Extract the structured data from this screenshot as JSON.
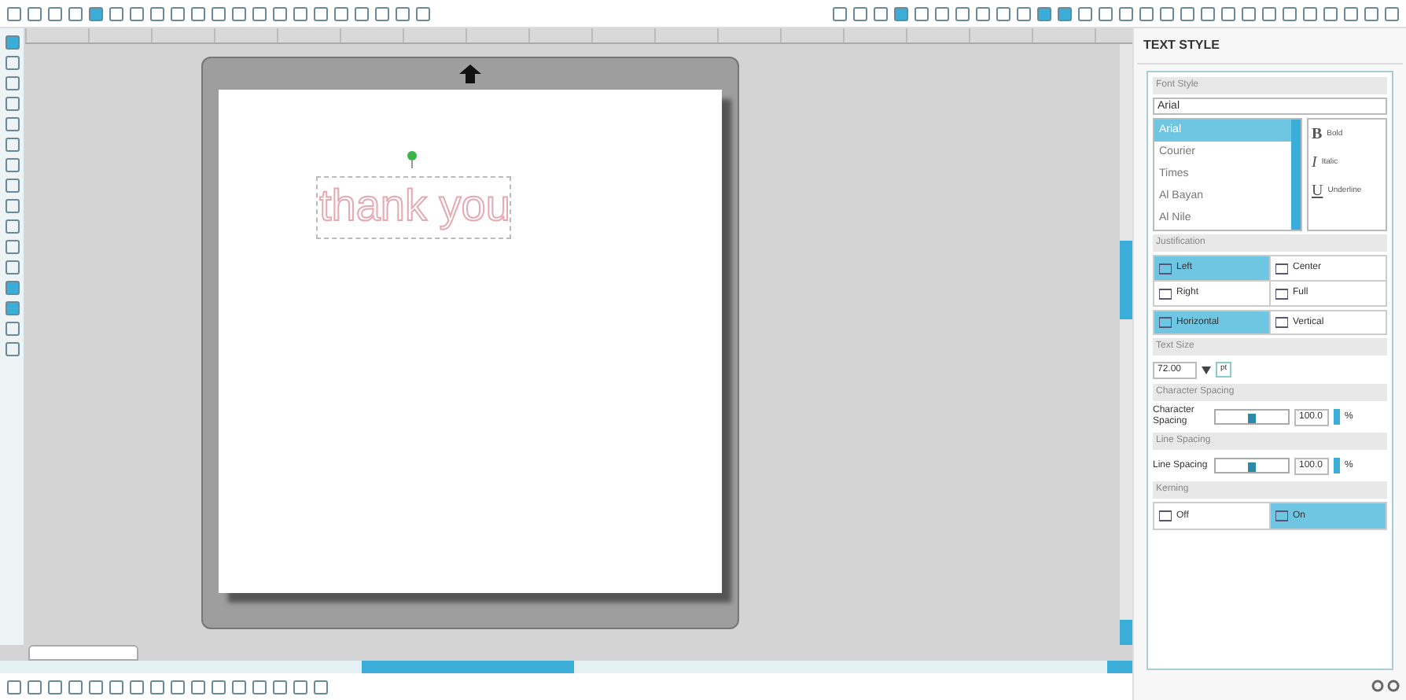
{
  "panel": {
    "title": "TEXT STYLE",
    "font_style": {
      "header": "Font Style",
      "font_field": "Arial",
      "fonts": [
        {
          "label": "Arial",
          "selected": true
        },
        {
          "label": "Courier",
          "selected": false
        },
        {
          "label": "Times",
          "selected": false
        },
        {
          "label": "Al Bayan",
          "selected": false
        },
        {
          "label": "Al Nile",
          "selected": false
        }
      ],
      "styles": [
        {
          "glyph": "B",
          "label": "Bold"
        },
        {
          "glyph": "I",
          "label": "Italic"
        },
        {
          "glyph": "U",
          "label": "Underline"
        }
      ]
    },
    "justification": {
      "header": "Justification",
      "options": [
        {
          "label": "Left",
          "selected": true
        },
        {
          "label": "Center",
          "selected": false
        },
        {
          "label": "Right",
          "selected": false
        },
        {
          "label": "Full",
          "selected": false
        }
      ],
      "orientation": [
        {
          "label": "Horizontal",
          "selected": true
        },
        {
          "label": "Vertical",
          "selected": false
        }
      ]
    },
    "text_size": {
      "header": "Text Size",
      "value": "72.00",
      "unit": "pt"
    },
    "character_spacing": {
      "header": "Character Spacing",
      "label": "Character Spacing",
      "level": 0.5,
      "value": "100.0",
      "unit": "%"
    },
    "line_spacing": {
      "header": "Line Spacing",
      "label": "Line Spacing",
      "level": 0.5,
      "value": "100.0",
      "unit": "%"
    },
    "kerning": {
      "header": "Kerning",
      "options": [
        {
          "label": "Off",
          "selected": false
        },
        {
          "label": "On",
          "selected": true
        }
      ]
    }
  },
  "canvas": {
    "text": "thank you"
  }
}
